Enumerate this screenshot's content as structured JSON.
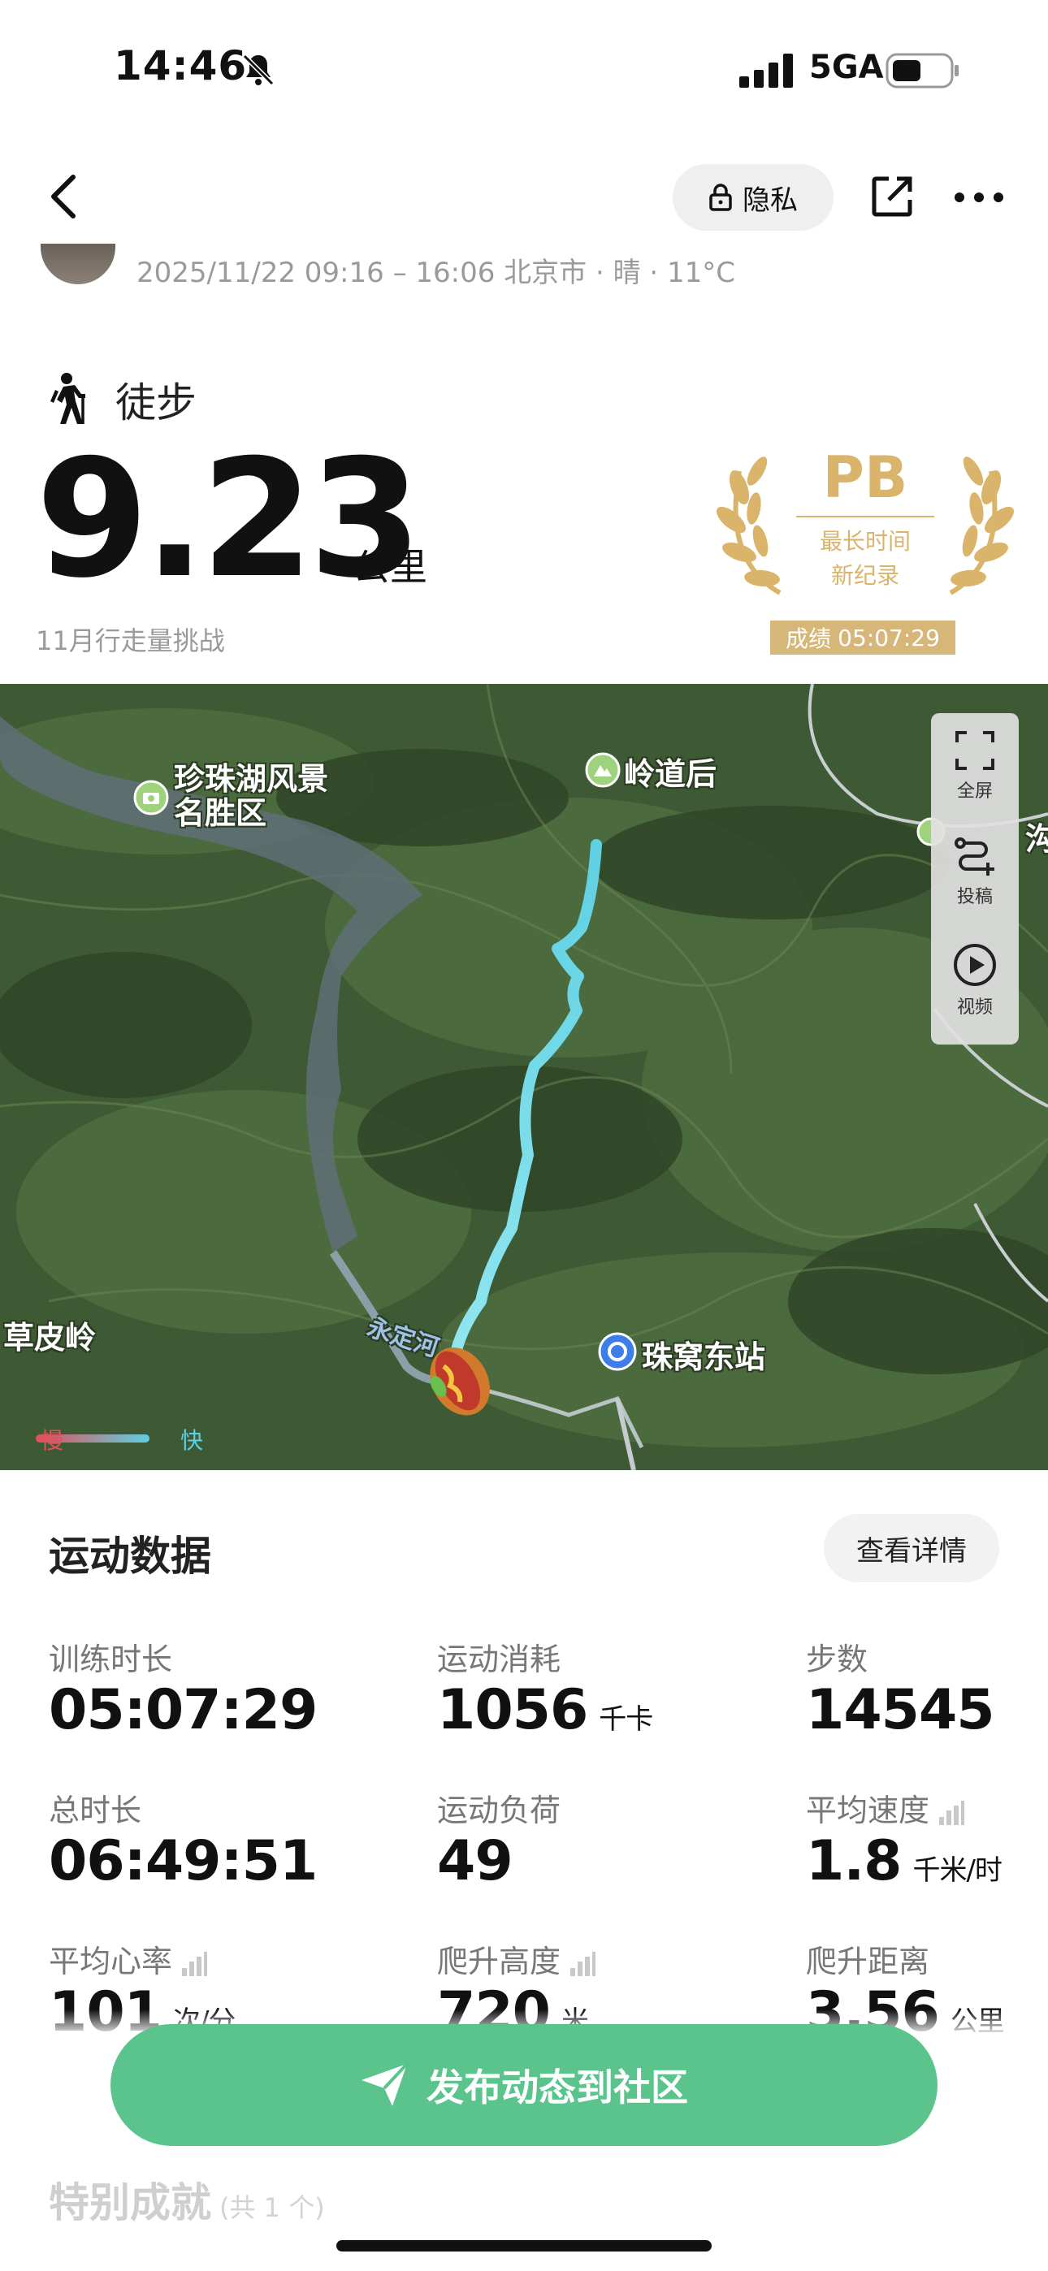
{
  "status_bar": {
    "time": "14:46",
    "network": "5GA"
  },
  "nav": {
    "privacy_label": "隐私"
  },
  "header": {
    "meta": "2025/11/22 09:16 – 16:06 北京市 · 晴 · 11°C",
    "sport": "徒步",
    "distance": "9.23",
    "distance_unit": "公里",
    "challenge": "11月行走量挑战"
  },
  "badge": {
    "pb": "PB",
    "line1": "最长时间",
    "line2": "新纪录",
    "result_label": "成绩",
    "result_value": "05:07:29"
  },
  "map": {
    "labels": {
      "lake": "珍珠湖风景名胜区",
      "lake_l1": "珍珠湖风景",
      "lake_l2": "名胜区",
      "peak": "岭道后",
      "village": "草皮岭",
      "station": "珠窝东站",
      "river": "永定河",
      "edge": "沟"
    },
    "tools": {
      "fullscreen": "全屏",
      "cast": "投稿",
      "video": "视频"
    },
    "legend": {
      "slow": "慢",
      "fast": "快"
    }
  },
  "stats": {
    "title": "运动数据",
    "detail_button": "查看详情",
    "items": [
      {
        "label": "训练时长",
        "value": "05:07:29",
        "unit": ""
      },
      {
        "label": "运动消耗",
        "value": "1056",
        "unit": "千卡"
      },
      {
        "label": "步数",
        "value": "14545",
        "unit": ""
      },
      {
        "label": "总时长",
        "value": "06:49:51",
        "unit": ""
      },
      {
        "label": "运动负荷",
        "value": "49",
        "unit": ""
      },
      {
        "label": "平均速度",
        "value": "1.8",
        "unit": "千米/时"
      },
      {
        "label": "平均心率",
        "value": "101",
        "unit": "次/分"
      },
      {
        "label": "爬升高度",
        "value": "720",
        "unit": "米"
      },
      {
        "label": "爬升距离",
        "value": "3.56",
        "unit": "公里"
      }
    ]
  },
  "publish_button": "发布动态到社区",
  "achievements": {
    "title": "特别成就",
    "count": "(共 1 个)"
  },
  "colors": {
    "accent_green": "#5ac48c",
    "gold": "#d7b779",
    "track_fast": "#5fd0e2",
    "track_slow": "#e0505a"
  },
  "icons": [
    "bell-off-icon",
    "signal-icon",
    "battery-icon",
    "back-icon",
    "lock-icon",
    "share-icon",
    "more-icon",
    "hiking-icon",
    "laurel-icon",
    "fullscreen-icon",
    "route-icon",
    "play-icon",
    "camera-pin-icon",
    "mountain-pin-icon",
    "station-pin-icon",
    "chart-bars-icon",
    "send-icon"
  ]
}
